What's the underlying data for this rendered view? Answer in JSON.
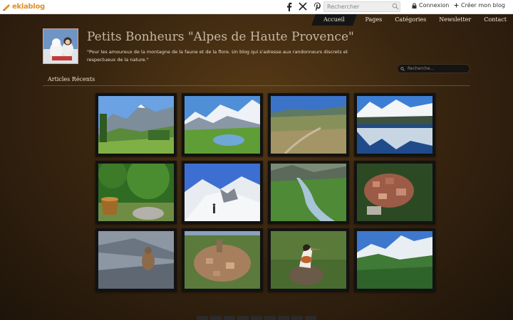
{
  "topbar": {
    "logo_text": "eklablog",
    "search_placeholder": "Rechercher",
    "connexion_label": "Connexion",
    "creer_label": "Créer mon blog",
    "social_icons": [
      "facebook-icon",
      "x-icon",
      "pinterest-icon"
    ]
  },
  "nav": {
    "items": [
      {
        "label": "Accueil"
      },
      {
        "label": "Pages"
      },
      {
        "label": "Catégories"
      },
      {
        "label": "Newsletter"
      },
      {
        "label": "Contact"
      }
    ]
  },
  "header": {
    "title": "Petits Bonheurs \"Alpes de Haute Provence\"",
    "description": "\"Pour les amoureux de la montagne de la faune et de la flore. Un blog qui s'adresse aux randonneurs discrets et respectueux de la nature.\"",
    "search_placeholder": "Recherche..."
  },
  "section": {
    "title": "Articles Récents"
  },
  "gallery": {
    "thumbnails": [
      {
        "subject": "mountain-valley-meadow"
      },
      {
        "subject": "snowy-peaks-lake"
      },
      {
        "subject": "river-valley-plain"
      },
      {
        "subject": "mountain-lake-reflection"
      },
      {
        "subject": "forest-flowers-pot"
      },
      {
        "subject": "snow-hiker"
      },
      {
        "subject": "mountain-stream"
      },
      {
        "subject": "village-rooftops"
      },
      {
        "subject": "marmot-rock"
      },
      {
        "subject": "hilltop-village"
      },
      {
        "subject": "grebe-bird"
      },
      {
        "subject": "snowy-mountain-range"
      }
    ]
  },
  "colors": {
    "brand_orange": "#e0902a",
    "title_color": "#c7b8a4",
    "nav_text": "#f0e6d6"
  }
}
